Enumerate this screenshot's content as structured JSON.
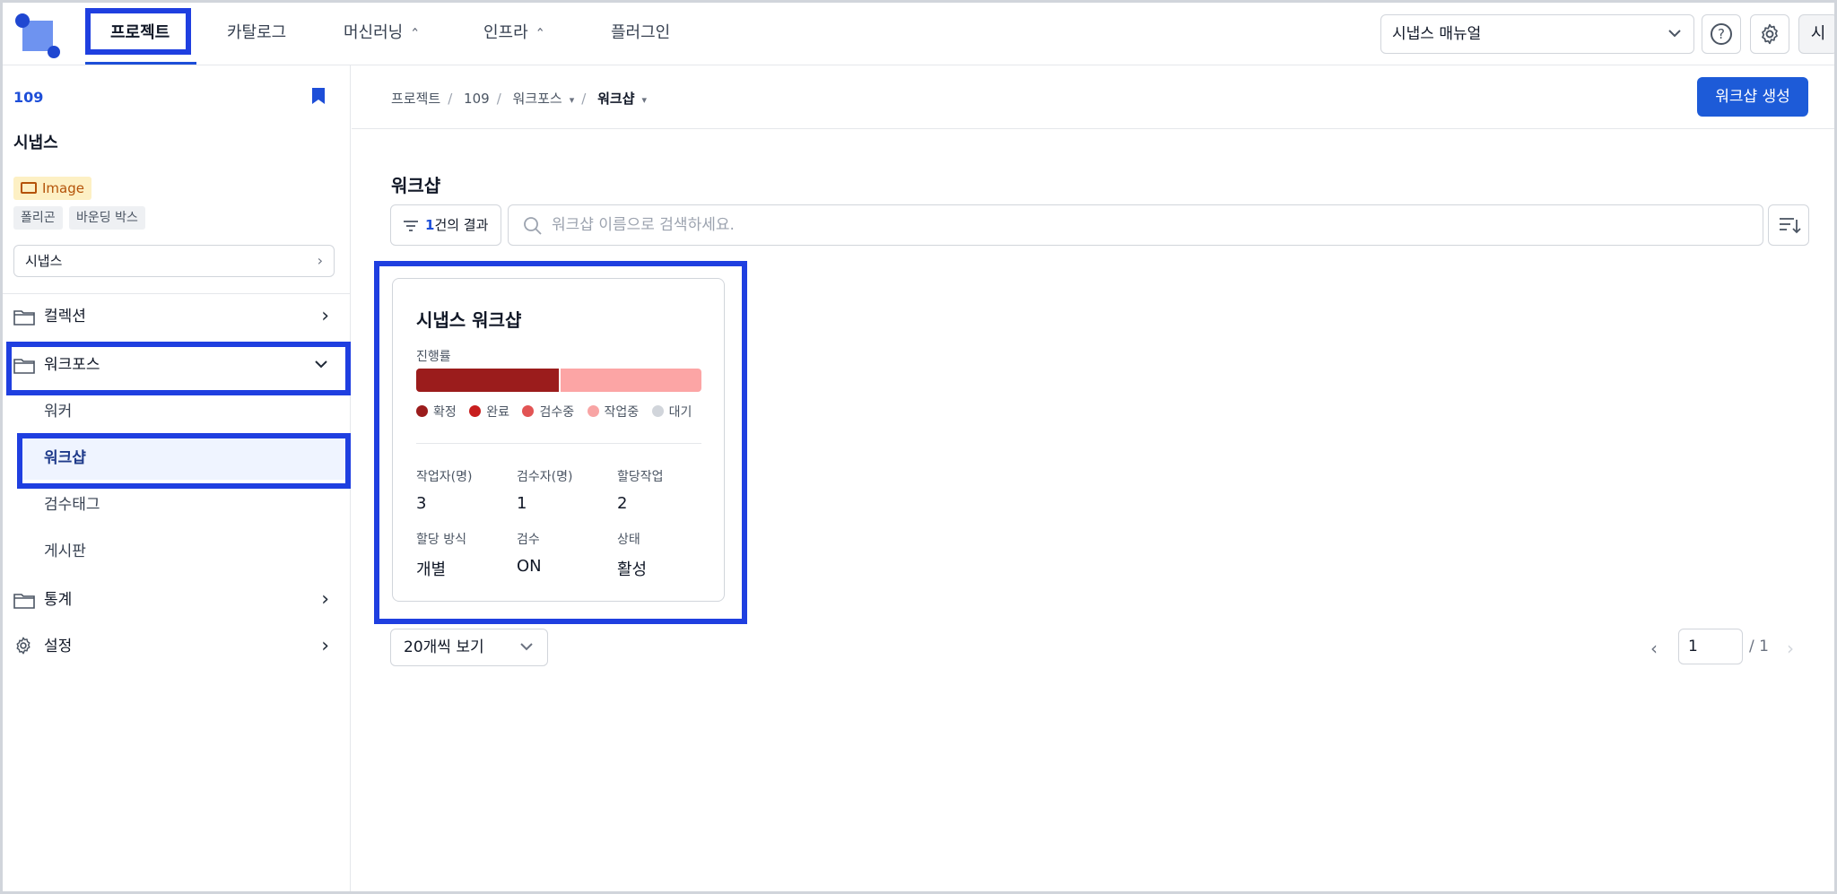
{
  "top_nav": {
    "items": [
      {
        "label": "프로젝트",
        "active": true
      },
      {
        "label": "카탈로그"
      },
      {
        "label": "머신러닝",
        "has_chevron": true
      },
      {
        "label": "인프라",
        "has_chevron": true
      },
      {
        "label": "플러그인"
      }
    ],
    "manual_select": "시냅스 매뉴얼",
    "help_icon": "question-circle-icon",
    "settings_icon": "gear-icon",
    "avatar_initial": "시"
  },
  "sidebar": {
    "project_id": "109",
    "project_name": "시냅스",
    "type_badge": "Image",
    "tags": [
      "폴리곤",
      "바운딩 박스"
    ],
    "project_select": "시냅스",
    "menu": {
      "collection": "컬렉션",
      "workforce": "워크포스",
      "workforce_sub": [
        "워커",
        "워크샵",
        "검수태그",
        "게시판"
      ],
      "statistics": "통계",
      "settings": "설정"
    }
  },
  "main": {
    "breadcrumb": [
      "프로젝트",
      "109",
      "워크포스",
      "워크샵"
    ],
    "create_button": "워크샵 생성",
    "page_title": "워크샵",
    "result_count": "1",
    "result_suffix": "건의 결과",
    "search_placeholder": "워크샵 이름으로 검색하세요.",
    "card": {
      "title": "시냅스 워크샵",
      "progress_label": "진행률",
      "progress": {
        "confirmed": 0.5,
        "in_progress": 0.5
      },
      "legend": [
        {
          "label": "확정",
          "color": "#9b1c1c"
        },
        {
          "label": "완료",
          "color": "#c81e1e"
        },
        {
          "label": "검수중",
          "color": "#e25454"
        },
        {
          "label": "작업중",
          "color": "#f8a4a4"
        },
        {
          "label": "대기",
          "color": "#d1d5db"
        }
      ],
      "stats": {
        "workers_label": "작업자(명)",
        "workers_value": "3",
        "reviewers_label": "검수자(명)",
        "reviewers_value": "1",
        "assigned_label": "할당작업",
        "assigned_value": "2",
        "assign_method_label": "할당 방식",
        "assign_method_value": "개별",
        "review_label": "검수",
        "review_value": "ON",
        "status_label": "상태",
        "status_value": "활성"
      }
    },
    "page_size": "20개씩 보기",
    "pager": {
      "current": "1",
      "total": "/ 1"
    }
  },
  "colors": {
    "accent": "#1d5bd8",
    "highlight": "#1f3fe0",
    "progress_done": "#9b1c1c",
    "progress_rest": "#fca5a5"
  }
}
